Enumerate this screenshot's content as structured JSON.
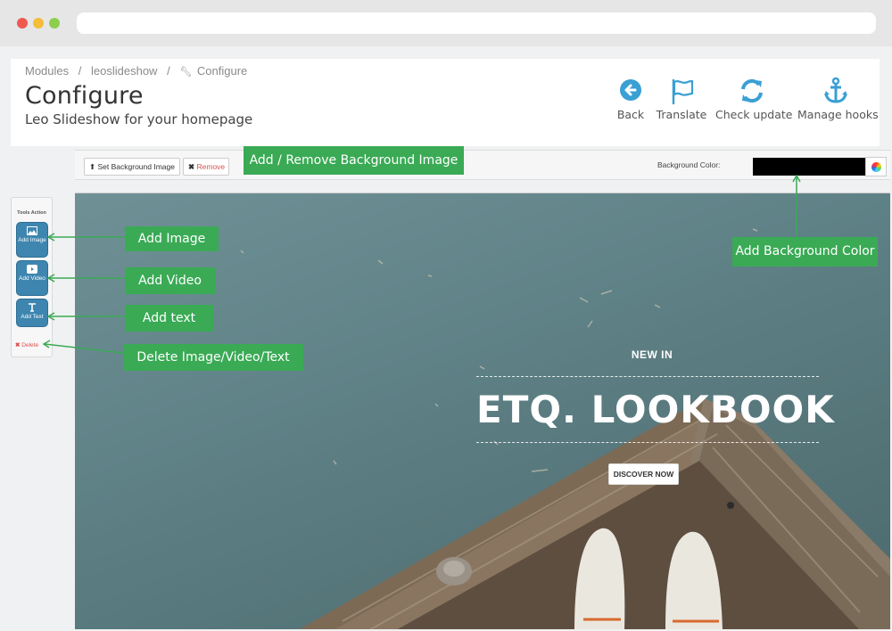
{
  "breadcrumb": {
    "items": [
      "Modules",
      "leoslideshow",
      "Configure"
    ],
    "separator": "/"
  },
  "page": {
    "title": "Configure",
    "subtitle": "Leo Slideshow for your homepage"
  },
  "toolbar": {
    "back": "Back",
    "translate": "Translate",
    "check_update": "Check update",
    "manage_hooks": "Manage hooks",
    "icon_color": "#3a9fd4"
  },
  "editor": {
    "set_background": "Set Background Image",
    "remove": "Remove",
    "background_color_label": "Background Color:",
    "background_color_value": "#000000"
  },
  "tools": {
    "title": "Tools Action",
    "add_image": "Add Image",
    "add_video": "Add Video",
    "add_text": "Add Text",
    "delete": "Delete"
  },
  "slide": {
    "eyebrow": "NEW IN",
    "title": "ETQ. LOOKBOOK",
    "button": "DISCOVER NOW"
  },
  "callouts": {
    "bg_image": "Add / Remove Background Image",
    "add_image": "Add Image",
    "add_video": "Add Video",
    "add_text": "Add text",
    "delete": "Delete Image/Video/Text",
    "bg_color": "Add Background Color",
    "color": "#3aaa55"
  }
}
